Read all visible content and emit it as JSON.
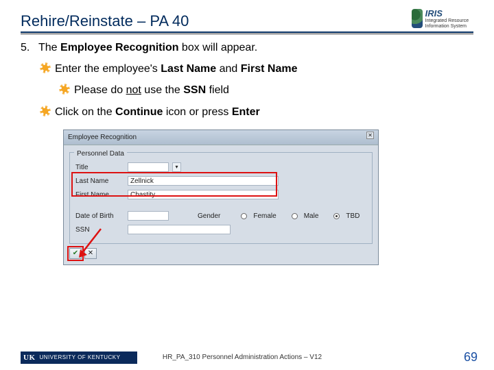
{
  "header": {
    "title": "Rehire/Reinstate – PA 40",
    "logo_brand": "IRIS",
    "logo_sub": "Integrated Resource Information System"
  },
  "step": {
    "number": "5.",
    "text_pre": "The ",
    "text_bold": "Employee Recognition",
    "text_post": " box will appear."
  },
  "bullets": {
    "b1a_pre": "Enter the employee's ",
    "b1a_bold1": "Last Name",
    "b1a_mid": " and ",
    "b1a_bold2": "First Name",
    "b2_pre": "Please do ",
    "b2_u": "not",
    "b2_mid": " use the ",
    "b2_bold": "SSN",
    "b2_post": " field",
    "b1b_pre": "Click on the ",
    "b1b_bold1": "Continue",
    "b1b_mid": " icon or press ",
    "b1b_bold2": "Enter"
  },
  "sap": {
    "title": "Employee Recognition",
    "group": "Personnel Data",
    "labels": {
      "title": "Title",
      "lastname": "Last Name",
      "firstname": "First Name",
      "dob": "Date of Birth",
      "gender": "Gender",
      "ssn": "SSN"
    },
    "values": {
      "lastname": "Zellnick",
      "firstname": "Chastity"
    },
    "radios": {
      "female": "Female",
      "male": "Male",
      "tbd": "TBD"
    },
    "buttons": {
      "ok": "✔",
      "cancel": "✕"
    }
  },
  "footer": {
    "center": "HR_PA_310 Personnel Administration Actions – V12",
    "page": "69",
    "uk_abbrev": "UK",
    "uk_name": "UNIVERSITY OF KENTUCKY"
  }
}
